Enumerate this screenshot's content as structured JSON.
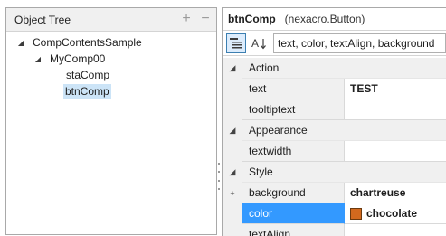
{
  "colors": {
    "selected_tree_bg": "#cce4f7",
    "selected_row_bg": "#3399ff",
    "chocolate_swatch": "#d2691e",
    "panel_header_bg": "#f0f0f0"
  },
  "object_tree": {
    "title": "Object Tree",
    "add_icon": "plus-icon",
    "remove_icon": "minus-icon",
    "nodes": [
      {
        "label": "CompContentsSample",
        "expanded": true,
        "level": 0
      },
      {
        "label": "MyComp00",
        "expanded": true,
        "level": 1
      },
      {
        "label": "staComp",
        "level": 2
      },
      {
        "label": "btnComp",
        "level": 2,
        "selected": true
      }
    ]
  },
  "properties": {
    "component_name": "btnComp",
    "component_type": "(nexacro.Button)",
    "toolbar": {
      "category_view_icon": "categorized-list-icon",
      "sort_icon": "sort-alphabetical-icon",
      "filter_value": "text, color, textAlign, background"
    },
    "rows": [
      {
        "kind": "category",
        "label": "Action"
      },
      {
        "kind": "property",
        "name": "text",
        "value": "TEST"
      },
      {
        "kind": "property",
        "name": "tooltiptext",
        "value": ""
      },
      {
        "kind": "category",
        "label": "Appearance"
      },
      {
        "kind": "property",
        "name": "textwidth",
        "value": ""
      },
      {
        "kind": "category",
        "label": "Style"
      },
      {
        "kind": "property",
        "name": "background",
        "value": "chartreuse",
        "expandable": true
      },
      {
        "kind": "property",
        "name": "color",
        "value": "chocolate",
        "selected": true,
        "swatch": true
      },
      {
        "kind": "property",
        "name": "textAlign",
        "value": ""
      }
    ]
  }
}
